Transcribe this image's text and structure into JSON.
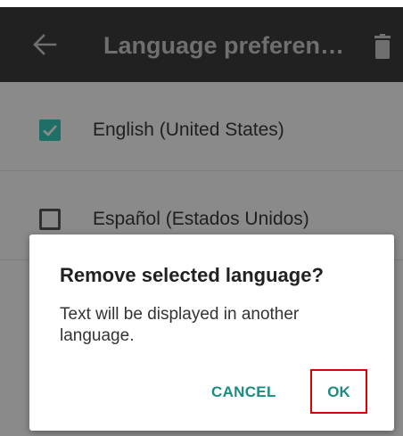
{
  "app_bar": {
    "title": "Language preferen…",
    "background": "#212121",
    "back_icon": "arrow-left-icon",
    "action_icon": "trash-icon"
  },
  "languages": [
    {
      "label": "English (United States)",
      "checked": true
    },
    {
      "label": "Español (Estados Unidos)",
      "checked": false
    }
  ],
  "dialog": {
    "title": "Remove selected language?",
    "message": "Text will be displayed in another language.",
    "cancel_label": "CANCEL",
    "ok_label": "OK",
    "button_color": "#1b8c80",
    "highlight_color": "#e10000"
  }
}
